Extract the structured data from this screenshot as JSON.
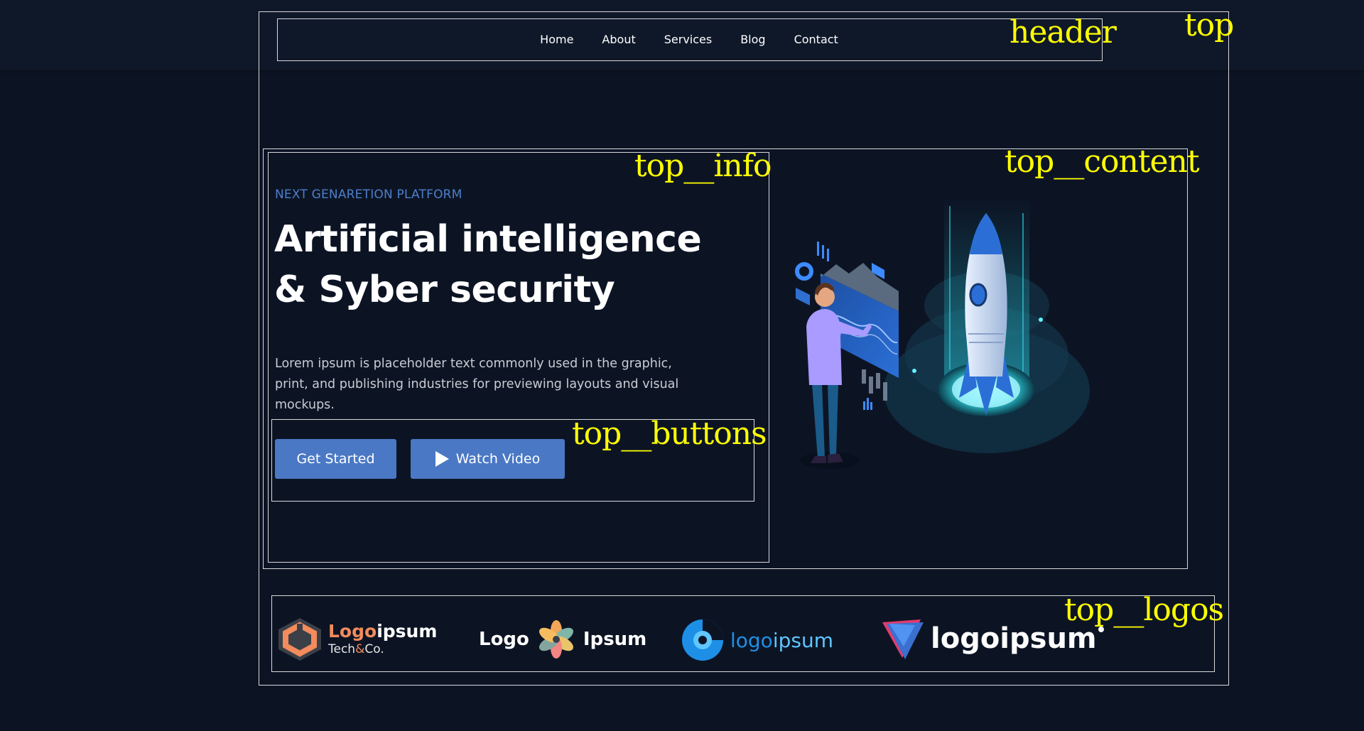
{
  "nav": {
    "items": [
      "Home",
      "About",
      "Services",
      "Blog",
      "Contact"
    ]
  },
  "debug_labels": {
    "top": "top",
    "header": "header",
    "top_info": "top__info",
    "top_content": "top__content",
    "top_buttons": "top__buttons",
    "top_logos": "top__logos"
  },
  "hero": {
    "eyebrow": "NEXT GENARETION PLATFORM",
    "title_line1": "Artificial intelligence",
    "title_line2": "& Syber security",
    "description": "Lorem ipsum is placeholder text commonly used in the graphic, print, and publishing industries for previewing layouts and visual mockups.",
    "buttons": {
      "get_started": "Get Started",
      "watch_video": "Watch Video"
    }
  },
  "logos": {
    "logo1": {
      "main_a": "Logo",
      "main_b": "ipsum",
      "sub_a": "Tech",
      "sub_amp": "&",
      "sub_b": "Co."
    },
    "logo2": {
      "left": "Logo",
      "right": "Ipsum"
    },
    "logo3": {
      "a": "logo",
      "b": "ipsum"
    },
    "logo4": {
      "text": "logoipsum"
    }
  },
  "colors": {
    "background": "#0c1424",
    "accent": "#4a78c4",
    "eyebrow": "#4d7fc9",
    "debug_label": "#ffff00",
    "logo_orange": "#f38b5c",
    "logo_blue": "#3aa0f0"
  }
}
